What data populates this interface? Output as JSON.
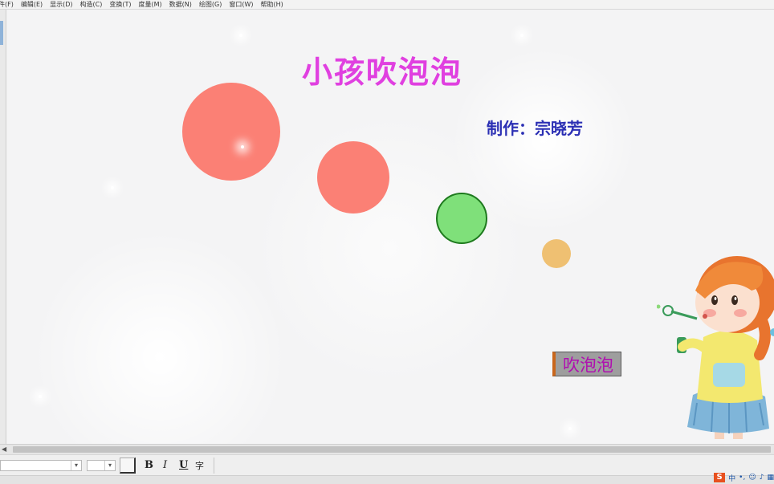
{
  "menu": [
    "件(F)",
    "编辑(E)",
    "显示(D)",
    "构造(C)",
    "变换(T)",
    "度量(M)",
    "数据(N)",
    "绘图(G)",
    "窗口(W)",
    "帮助(H)"
  ],
  "canvas": {
    "title": "小孩吹泡泡",
    "author": "制作：宗晓芳",
    "button_label": "吹泡泡",
    "colors": {
      "title": "#e040e0",
      "author": "#2b2fb4",
      "bubble_large": "#fb8075",
      "bubble_medium": "#fb8075",
      "bubble_green": "#7fe07a",
      "bubble_small": "#efc072"
    }
  },
  "text_toolbar": {
    "bold_label": "B",
    "italic_label": "I",
    "underline_label": "U",
    "special_label": "字"
  },
  "ime": {
    "logo": "S",
    "lang": "中"
  }
}
